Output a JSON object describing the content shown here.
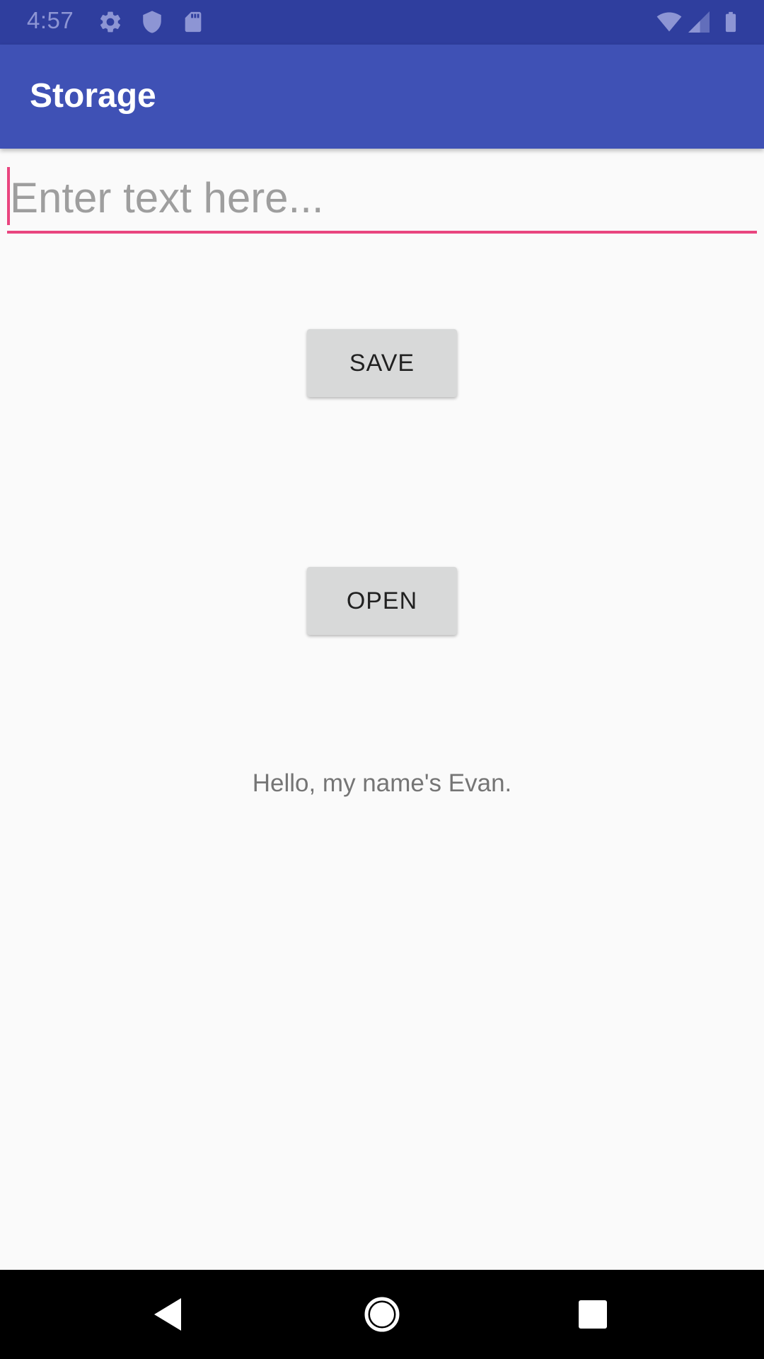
{
  "status_bar": {
    "time": "4:57",
    "icons_left": [
      "gear-icon",
      "shield-icon",
      "sd-card-icon"
    ],
    "icons_right": [
      "wifi-icon",
      "cell-signal-icon",
      "battery-icon"
    ]
  },
  "app_bar": {
    "title": "Storage"
  },
  "text_field": {
    "placeholder": "Enter text here...",
    "value": ""
  },
  "buttons": {
    "save_label": "SAVE",
    "open_label": "OPEN"
  },
  "output": {
    "text": "Hello, my name's Evan."
  },
  "nav_bar": {
    "buttons": [
      "back-icon",
      "home-icon",
      "recents-icon"
    ]
  },
  "colors": {
    "status_bar": "#2f3e9e",
    "app_bar": "#3f51b5",
    "accent": "#e9457f",
    "background": "#fafafa",
    "button": "#d8d9d9"
  }
}
